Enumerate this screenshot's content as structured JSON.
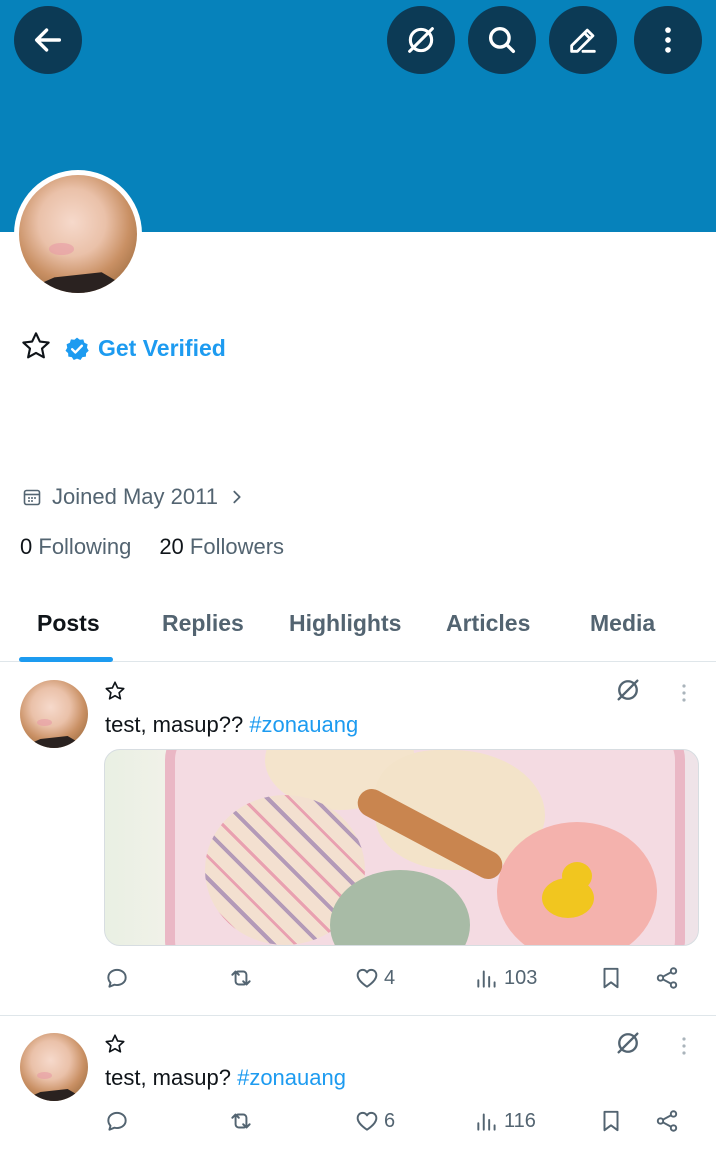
{
  "header": {
    "back_icon": "arrow-left-icon",
    "grok_icon": "grok-icon",
    "search_icon": "search-icon",
    "edit_icon": "pencil-icon",
    "more_icon": "more-vertical-icon",
    "banner_color": "#0682bb"
  },
  "profile": {
    "get_verified_label": "Get Verified",
    "joined_label": "Joined May 2011",
    "following_count": "0",
    "following_label": "Following",
    "followers_count": "20",
    "followers_label": "Followers"
  },
  "tabs": [
    {
      "label": "Posts",
      "active": true
    },
    {
      "label": "Replies",
      "active": false
    },
    {
      "label": "Highlights",
      "active": false
    },
    {
      "label": "Articles",
      "active": false
    },
    {
      "label": "Media",
      "active": false
    }
  ],
  "posts": [
    {
      "text": "test, masup??",
      "hashtag": "#zonauang",
      "has_media": true,
      "likes": "4",
      "views": "103"
    },
    {
      "text": "test, masup?",
      "hashtag": "#zonauang",
      "has_media": false,
      "likes": "6",
      "views": "116"
    }
  ],
  "colors": {
    "accent": "#1d9bf0",
    "text": "#0f1419",
    "secondary": "#536471",
    "header_button": "#0c3a55"
  }
}
